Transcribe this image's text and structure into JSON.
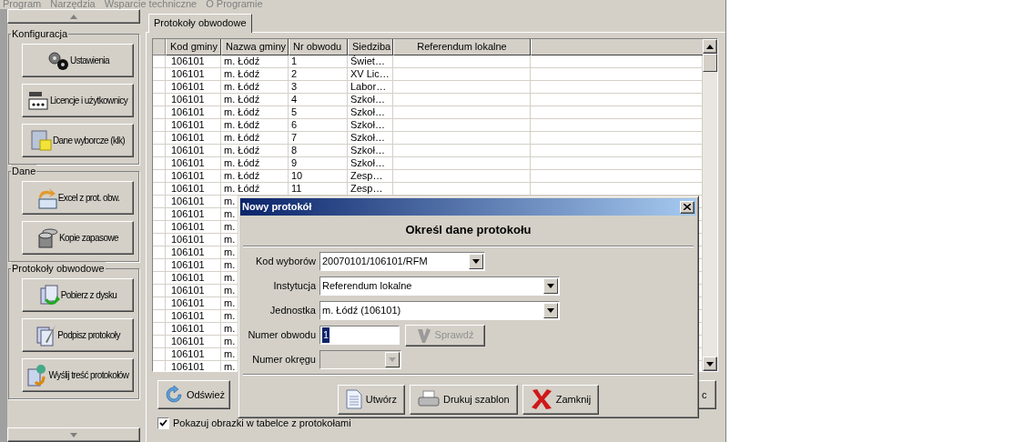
{
  "menu": [
    {
      "label": "Program",
      "disabled": true
    },
    {
      "label": "Narzędzia",
      "disabled": true
    },
    {
      "label": "Wsparcie techniczne",
      "disabled": true
    },
    {
      "label": "O Programie",
      "disabled": true
    }
  ],
  "sidebar": {
    "groups": [
      {
        "title": "Konfiguracja",
        "buttons": [
          "Ustawienia",
          "Licencje i użytkownicy",
          "Dane wyborcze (klk)"
        ]
      },
      {
        "title": "Dane",
        "buttons": [
          "Excel z prot. obw.",
          "Kopie zapasowe"
        ]
      },
      {
        "title": "Protokoły obwodowe",
        "buttons": [
          "Pobierz z dysku",
          "Podpisz protokoły",
          "Wyślij treść protokołów"
        ]
      }
    ]
  },
  "tabs": [
    {
      "label": "Protokoły obwodowe",
      "selected": true
    }
  ],
  "table": {
    "columns": [
      "Kod gminy",
      "Nazwa gminy",
      "Nr obwodu",
      "Siedziba",
      "Referendum lokalne"
    ],
    "rows": [
      [
        "106101",
        "m. Łódź",
        "1",
        "Świet…"
      ],
      [
        "106101",
        "m. Łódź",
        "2",
        "XV Lic…"
      ],
      [
        "106101",
        "m. Łódź",
        "3",
        "Labor…"
      ],
      [
        "106101",
        "m. Łódź",
        "4",
        "Szkoł…"
      ],
      [
        "106101",
        "m. Łódź",
        "5",
        "Szkoł…"
      ],
      [
        "106101",
        "m. Łódź",
        "6",
        "Szkoł…"
      ],
      [
        "106101",
        "m. Łódź",
        "7",
        "Szkoł…"
      ],
      [
        "106101",
        "m. Łódź",
        "8",
        "Szkoł…"
      ],
      [
        "106101",
        "m. Łódź",
        "9",
        "Szkoł…"
      ],
      [
        "106101",
        "m. Łódź",
        "10",
        "Zesp…"
      ],
      [
        "106101",
        "m. Łódź",
        "11",
        "Zesp…"
      ],
      [
        "106101",
        "m."
      ],
      [
        "106101",
        "m."
      ],
      [
        "106101",
        "m."
      ],
      [
        "106101",
        "m."
      ],
      [
        "106101",
        "m."
      ],
      [
        "106101",
        "m."
      ],
      [
        "106101",
        "m."
      ],
      [
        "106101",
        "m."
      ],
      [
        "106101",
        "m."
      ],
      [
        "106101",
        "m."
      ],
      [
        "106101",
        "m."
      ],
      [
        "106101",
        "m."
      ],
      [
        "106101",
        "m."
      ],
      [
        "106101",
        "m."
      ]
    ]
  },
  "bottom_buttons": [
    "Odśwież",
    "c"
  ],
  "show_images_checkbox": {
    "label": "Pokazuj obrazki w tabelce z protokołami",
    "checked": true
  },
  "dialog": {
    "title": "Nowy protokół",
    "heading": "Określ dane protokołu",
    "fields": [
      {
        "label": "Kod wyborów",
        "kind": "select",
        "value": "20070101/106101/RFM",
        "disabled": false
      },
      {
        "label": "Instytucja",
        "kind": "select",
        "value": "Referendum lokalne",
        "disabled": false
      },
      {
        "label": "Jednostka",
        "kind": "select",
        "value": "m. Łódź (106101)",
        "disabled": false
      },
      {
        "label": "Numer obwodu",
        "kind": "input",
        "value": "1",
        "disabled": false,
        "button": {
          "label": "Sprawdź",
          "disabled": true
        }
      },
      {
        "label": "Numer okręgu",
        "kind": "select",
        "disabled": true
      }
    ],
    "buttons": [
      "Utwórz",
      "Drukuj szablon",
      "Zamknij"
    ]
  }
}
